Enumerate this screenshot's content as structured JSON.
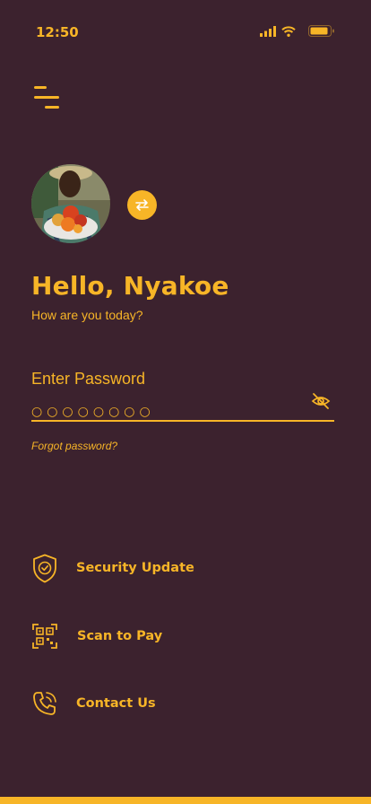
{
  "status_bar": {
    "time": "12:50"
  },
  "greeting": {
    "title": "Hello, Nyakoe",
    "subtitle": "How are you today?"
  },
  "password": {
    "label": "Enter Password",
    "masked_value": "○○○○○○○○",
    "forgot_link": "Forgot password?"
  },
  "menu": [
    {
      "label": "Security Update",
      "icon": "shield-check-icon"
    },
    {
      "label": "Scan to Pay",
      "icon": "qr-scan-icon"
    },
    {
      "label": "Contact Us",
      "icon": "phone-call-icon"
    }
  ],
  "colors": {
    "background": "#3c222e",
    "accent": "#f7b527"
  }
}
